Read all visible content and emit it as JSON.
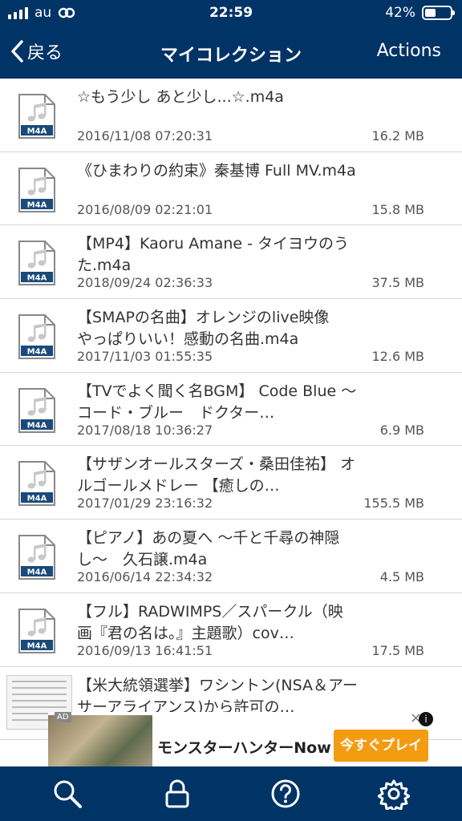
{
  "status_bar": {
    "carrier": "au",
    "time": "22:59",
    "battery_percent": "42%",
    "battery_level": 0.42
  },
  "nav": {
    "back_label": "戻る",
    "title": "マイコレクション",
    "actions_label": "Actions"
  },
  "file_type_label": "M4A",
  "files": [
    {
      "name": "☆もう少し あと少し...☆.m4a",
      "date": "2016/11/08 07:20:31",
      "size": "16.2 MB"
    },
    {
      "name": "《ひまわりの約束》秦基博 Full MV.m4a",
      "date": "2016/08/09 02:21:01",
      "size": "15.8 MB"
    },
    {
      "name": "【MP4】Kaoru Amane - タイヨウのうた.m4a",
      "date": "2018/09/24 02:36:33",
      "size": "37.5 MB"
    },
    {
      "name": "【SMAPの名曲】オレンジのlive映像　やっぱりいい！感動の名曲.m4a",
      "date": "2017/11/03 01:55:35",
      "size": "12.6 MB"
    },
    {
      "name": "【TVでよく聞く名BGM】 Code Blue 〜コード・ブルー　ドクター…",
      "date": "2017/08/18 10:36:27",
      "size": "6.9 MB"
    },
    {
      "name": "【サザンオールスターズ・桑田佳祐】 オルゴールメドレー 【癒しの…",
      "date": "2017/01/29 23:16:32",
      "size": "155.5 MB"
    },
    {
      "name": "【ピアノ】あの夏へ 〜千と千尋の神隠し〜　久石譲.m4a",
      "date": "2016/06/14 22:34:32",
      "size": "4.5 MB"
    },
    {
      "name": "【フル】RADWIMPS／スパークル（映画『君の名は。』主題歌）cov…",
      "date": "2016/09/13 16:41:51",
      "size": "17.5 MB"
    },
    {
      "name": "【米大統領選挙】ワシントン(NSA＆アーサーアライアンス)から許可の…",
      "date": "",
      "size": ""
    }
  ],
  "ad": {
    "badge": "AD",
    "text": "モンスターハンターNow",
    "button": "今すぐプレイ",
    "close": "×",
    "info": "i"
  },
  "tabbar": {
    "icons": [
      "search-icon",
      "lock-icon",
      "help-icon",
      "settings-icon"
    ]
  },
  "colors": {
    "bar": "#003366",
    "accent": "#f39c12",
    "icon_blue": "#1a4a7a"
  }
}
